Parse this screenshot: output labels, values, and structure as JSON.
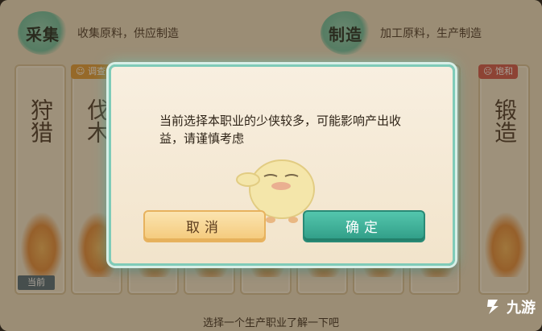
{
  "categories": {
    "gather": {
      "seal": "采集",
      "desc": "收集原料，供应制造"
    },
    "craft": {
      "seal": "制造",
      "desc": "加工原料，生产制造"
    }
  },
  "cards": [
    {
      "name": "狩猎",
      "badge": null,
      "current": true
    },
    {
      "name": "伐木",
      "badge": "good",
      "current": false
    },
    {
      "name": "",
      "badge": null,
      "current": false
    },
    {
      "name": "",
      "badge": null,
      "current": false
    },
    {
      "name": "",
      "badge": null,
      "current": false
    },
    {
      "name": "",
      "badge": null,
      "current": false
    },
    {
      "name": "",
      "badge": null,
      "current": false
    },
    {
      "name": "",
      "badge": null,
      "current": false
    },
    {
      "name": "锻造",
      "badge": "full",
      "current": false
    }
  ],
  "badges": {
    "good": "☺ 调查",
    "full": "☹ 饱和"
  },
  "current_tag": "当前",
  "bottom_hint": "选择一个生产职业了解一下吧",
  "modal": {
    "message": "当前选择本职业的少侠较多，可能影响产出收益，请谨慎考虑",
    "cancel": "取消",
    "confirm": "确定"
  },
  "watermark": "九游",
  "colors": {
    "accent": "#3aa993",
    "cancel": "#f4c97a",
    "seal": "#6cbfa1"
  }
}
